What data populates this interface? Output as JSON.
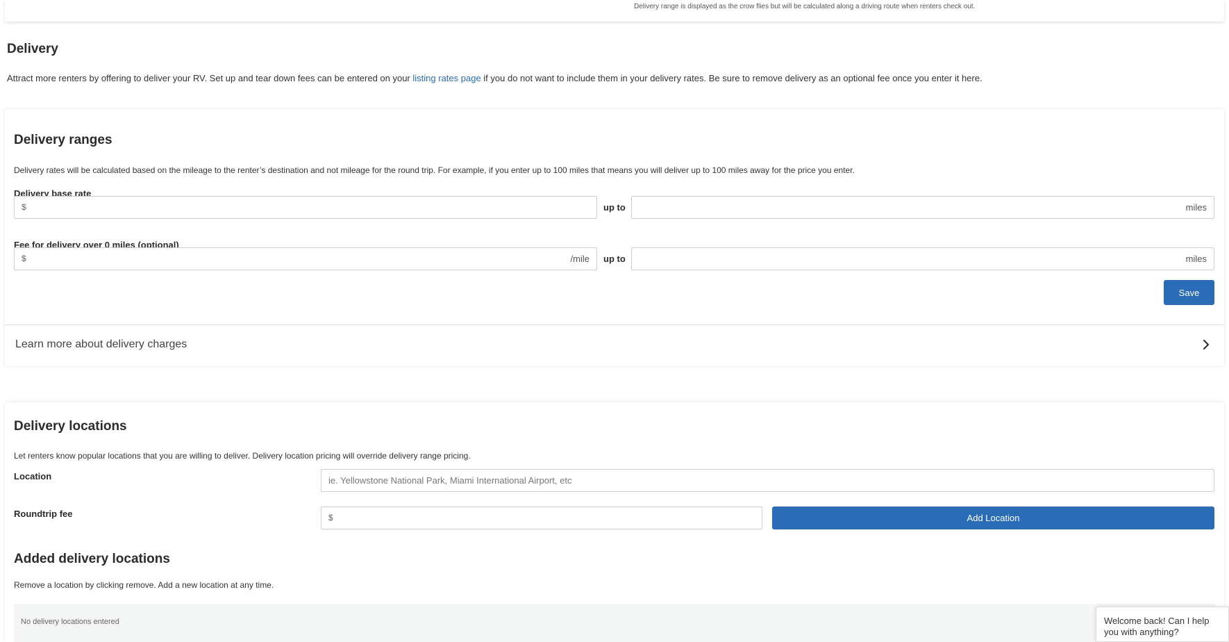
{
  "top_note": "Delivery range is displayed as the crow flies but will be calculated along a driving route when renters check out.",
  "delivery": {
    "title": "Delivery",
    "intro_before": "Attract more renters by offering to deliver your RV. Set up and tear down fees can be entered on your ",
    "intro_link": "listing rates page",
    "intro_after": " if you do not want to include them in your delivery rates. Be sure to remove delivery as an optional fee once you enter it here."
  },
  "ranges": {
    "title": "Delivery ranges",
    "description": "Delivery rates will be calculated based on the mileage to the renter’s destination and not mileage for the round trip. For example, if you enter up to 100 miles that means you will deliver up to 100 miles away for the price you enter.",
    "base_rate_label": "Delivery base rate",
    "base_rate_prefix": "$",
    "up_to_label": "up to",
    "miles_suffix": "miles",
    "fee_label": "Fee for delivery over 0 miles (optional)",
    "fee_prefix": "$",
    "fee_suffix": "/mile",
    "save_label": "Save",
    "learn_more": "Learn more about delivery charges"
  },
  "locations": {
    "title": "Delivery locations",
    "description": "Let renters know popular locations that you are willing to deliver. Delivery location pricing will override delivery range pricing.",
    "location_label": "Location",
    "location_placeholder": "ie. Yellowstone National Park, Miami International Airport, etc",
    "roundtrip_label": "Roundtrip fee",
    "roundtrip_prefix": "$",
    "add_label": "Add Location",
    "added_title": "Added delivery locations",
    "added_description": "Remove a location by clicking remove. Add a new location at any time.",
    "empty_text": "No delivery locations entered"
  },
  "chat": {
    "message": "Welcome back! Can I help you with anything?"
  },
  "colors": {
    "accent": "#2a6cb5",
    "link": "#2a6cb0"
  },
  "icons": {
    "learn_more": "chevron-right-icon"
  }
}
